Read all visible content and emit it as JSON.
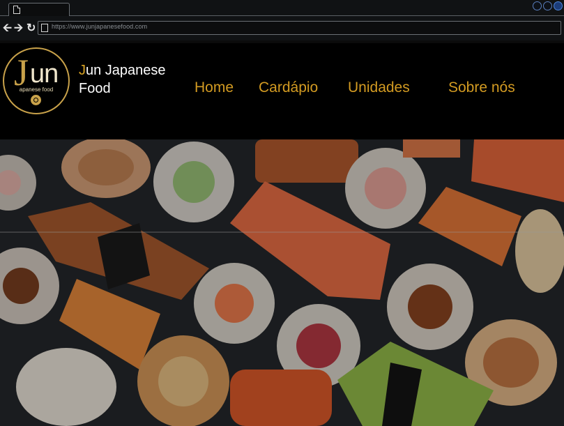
{
  "browser": {
    "url": "https://www.junjapanesefood.com"
  },
  "logo": {
    "letter_j": "J",
    "letters_un": "un",
    "tagline": "apanese food"
  },
  "brand": {
    "first_letter": "J",
    "rest_line1": "un Japanese",
    "line2": "Food"
  },
  "nav": {
    "items": [
      "Home",
      "Cardápio",
      "Unidades",
      "Sobre nós"
    ]
  },
  "colors": {
    "accent": "#d39b22",
    "header_bg": "#000000"
  }
}
